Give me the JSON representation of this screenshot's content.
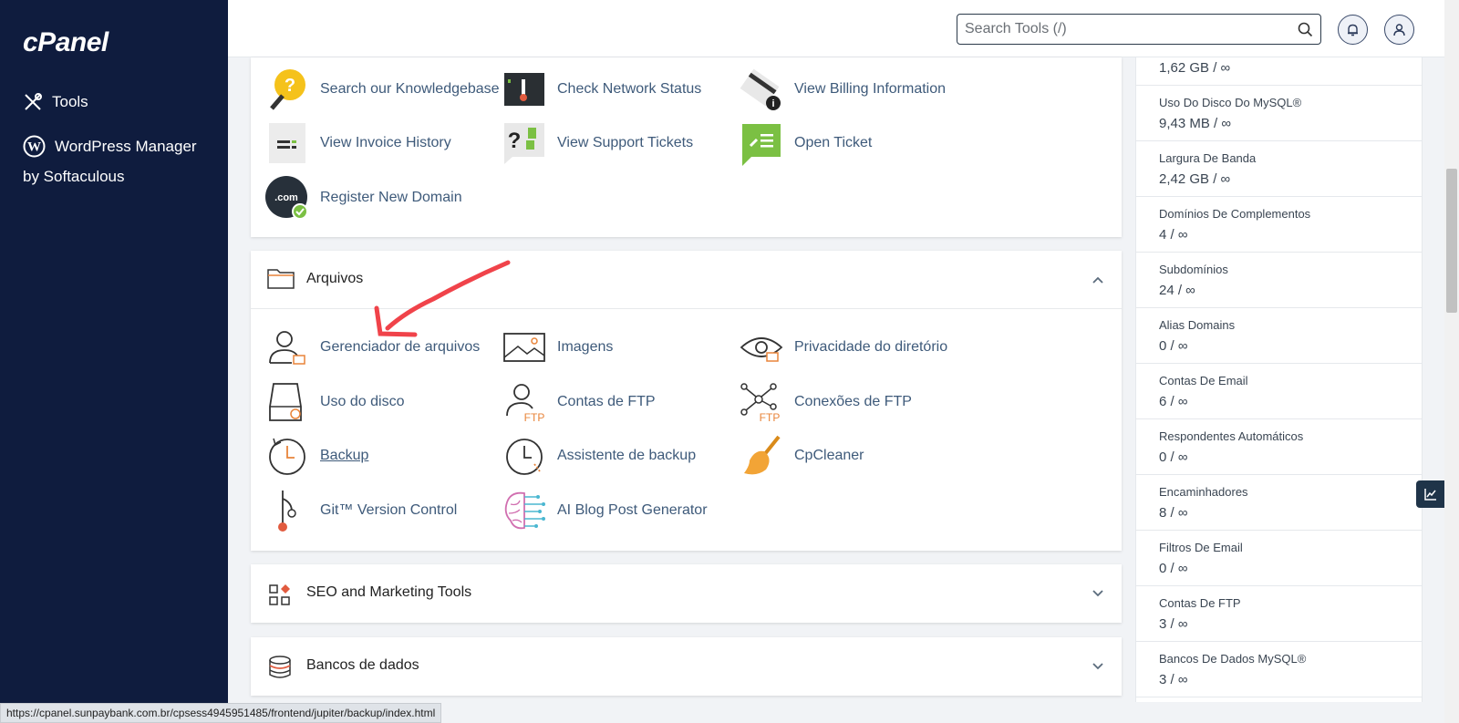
{
  "sidebar": {
    "logo": "cPanel",
    "items": [
      {
        "label": "Tools"
      },
      {
        "label": "WordPress Manager"
      }
    ],
    "sub_label": "by Softaculous"
  },
  "header": {
    "search_placeholder": "Search Tools (/)"
  },
  "top_section": {
    "tools": [
      {
        "label": "Search our Knowledgebase",
        "icon": "knowledgebase-icon"
      },
      {
        "label": "Check Network Status",
        "icon": "network-status-icon"
      },
      {
        "label": "View Billing Information",
        "icon": "billing-icon"
      },
      {
        "label": "View Invoice History",
        "icon": "invoice-icon"
      },
      {
        "label": "View Support Tickets",
        "icon": "support-tickets-icon"
      },
      {
        "label": "Open Ticket",
        "icon": "open-ticket-icon"
      },
      {
        "label": "Register New Domain",
        "icon": "domain-icon",
        "badge": ".com"
      }
    ]
  },
  "files_section": {
    "title": "Arquivos",
    "tools": [
      {
        "label": "Gerenciador de arquivos",
        "icon": "file-manager-icon"
      },
      {
        "label": "Imagens",
        "icon": "images-icon"
      },
      {
        "label": "Privacidade do diretório",
        "icon": "directory-privacy-icon"
      },
      {
        "label": "Uso do disco",
        "icon": "disk-usage-icon"
      },
      {
        "label": "Contas de FTP",
        "icon": "ftp-accounts-icon",
        "badge": "FTP"
      },
      {
        "label": "Conexões de FTP",
        "icon": "ftp-connections-icon",
        "badge": "FTP"
      },
      {
        "label": "Backup",
        "icon": "backup-icon"
      },
      {
        "label": "Assistente de backup",
        "icon": "backup-wizard-icon"
      },
      {
        "label": "CpCleaner",
        "icon": "broom-icon"
      },
      {
        "label": "Git™ Version Control",
        "icon": "git-icon"
      },
      {
        "label": "AI Blog Post Generator",
        "icon": "ai-brain-icon"
      }
    ]
  },
  "seo_section": {
    "title": "SEO and Marketing Tools"
  },
  "db_section": {
    "title": "Bancos de dados"
  },
  "stats": [
    {
      "label": "",
      "value": "1,62 GB / ∞"
    },
    {
      "label": "Uso Do Disco Do MySQL®",
      "value": "9,43 MB / ∞"
    },
    {
      "label": "Largura De Banda",
      "value": "2,42 GB / ∞"
    },
    {
      "label": "Domínios De Complementos",
      "value": "4 / ∞"
    },
    {
      "label": "Subdomínios",
      "value": "24 / ∞"
    },
    {
      "label": "Alias Domains",
      "value": "0 / ∞"
    },
    {
      "label": "Contas De Email",
      "value": "6 / ∞"
    },
    {
      "label": "Respondentes Automáticos",
      "value": "0 / ∞"
    },
    {
      "label": "Encaminhadores",
      "value": "8 / ∞"
    },
    {
      "label": "Filtros De Email",
      "value": "0 / ∞"
    },
    {
      "label": "Contas De FTP",
      "value": "3 / ∞"
    },
    {
      "label": "Bancos De Dados MySQL®",
      "value": "3 / ∞"
    }
  ],
  "status_bar": {
    "url": "https://cpanel.sunpaybank.com.br/cpsess4945951485/frontend/jupiter/backup/index.html"
  },
  "colors": {
    "sidebar": "#0f1c3e",
    "link": "#3e5a7a",
    "accent_orange": "#e8843a",
    "annotation_red": "#f0434a"
  }
}
